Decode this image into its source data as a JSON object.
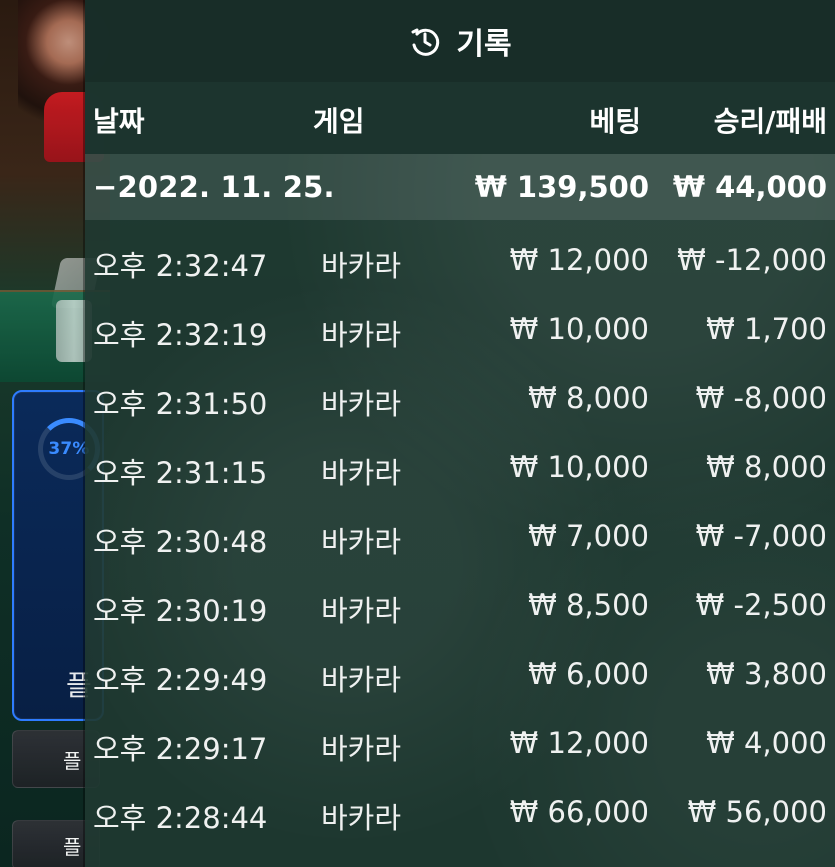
{
  "left_panel": {
    "progress_label": "37%",
    "side_char": "플",
    "btn1_label": "플",
    "btn2_label": "플"
  },
  "records": {
    "title": "기록",
    "columns": {
      "date": "날짜",
      "game": "게임",
      "bet": "베팅",
      "win_loss": "승리/패배"
    },
    "summary": {
      "date": "−2022. 11. 25.",
      "bet": "₩ 139,500",
      "win_loss": "₩ 44,000"
    },
    "rows": [
      {
        "time": "오후 2:32:47",
        "game": "바카라",
        "bet": "₩ 12,000",
        "win_loss": "₩ -12,000"
      },
      {
        "time": "오후 2:32:19",
        "game": "바카라",
        "bet": "₩ 10,000",
        "win_loss": "₩ 1,700"
      },
      {
        "time": "오후 2:31:50",
        "game": "바카라",
        "bet": "₩ 8,000",
        "win_loss": "₩ -8,000"
      },
      {
        "time": "오후 2:31:15",
        "game": "바카라",
        "bet": "₩ 10,000",
        "win_loss": "₩ 8,000"
      },
      {
        "time": "오후 2:30:48",
        "game": "바카라",
        "bet": "₩ 7,000",
        "win_loss": "₩ -7,000"
      },
      {
        "time": "오후 2:30:19",
        "game": "바카라",
        "bet": "₩ 8,500",
        "win_loss": "₩ -2,500"
      },
      {
        "time": "오후 2:29:49",
        "game": "바카라",
        "bet": "₩ 6,000",
        "win_loss": "₩ 3,800"
      },
      {
        "time": "오후 2:29:17",
        "game": "바카라",
        "bet": "₩ 12,000",
        "win_loss": "₩ 4,000"
      },
      {
        "time": "오후 2:28:44",
        "game": "바카라",
        "bet": "₩ 66,000",
        "win_loss": "₩ 56,000"
      }
    ]
  }
}
